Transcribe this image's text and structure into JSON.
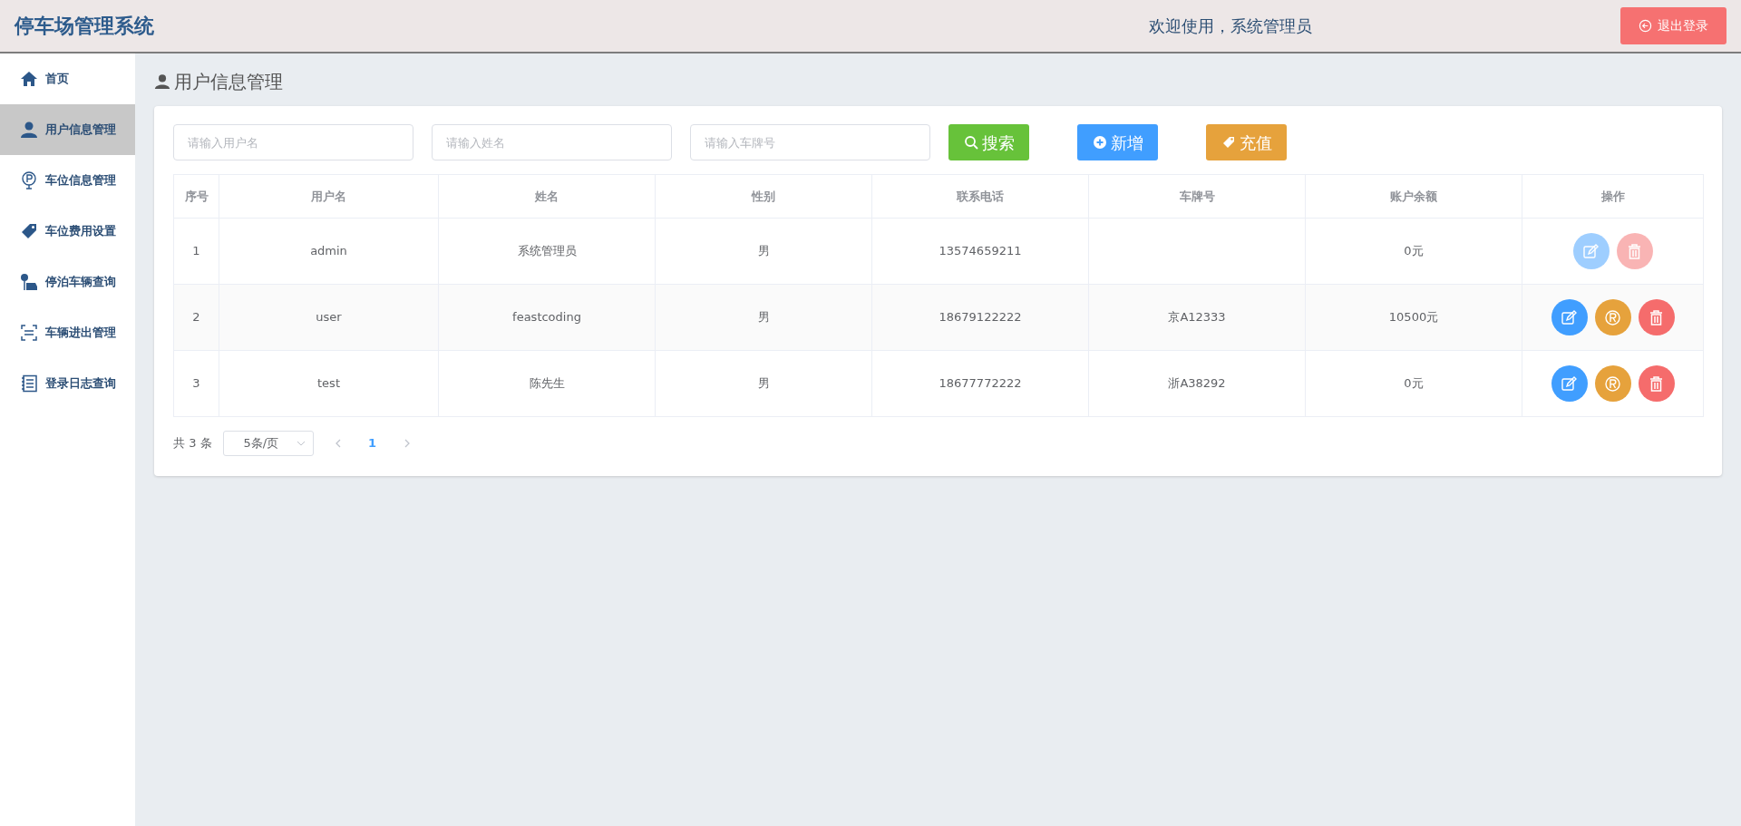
{
  "header": {
    "title": "停车场管理系统",
    "welcome": "欢迎使用，系统管理员",
    "logout_button": "退出登录"
  },
  "sidebar": {
    "items": [
      {
        "label": "首页",
        "kind": "home",
        "selected": false
      },
      {
        "label": "用户信息管理",
        "kind": "user",
        "selected": true
      },
      {
        "label": "车位信息管理",
        "kind": "parking",
        "selected": false
      },
      {
        "label": "车位费用设置",
        "kind": "tag",
        "selected": false
      },
      {
        "label": "停泊车辆查询",
        "kind": "car",
        "selected": false
      },
      {
        "label": "车辆进出管理",
        "kind": "scan",
        "selected": false
      },
      {
        "label": "登录日志查询",
        "kind": "notebook",
        "selected": false
      }
    ]
  },
  "page_title": "用户信息管理",
  "filters": [
    {
      "placeholder": "请输入用户名"
    },
    {
      "placeholder": "请输入姓名"
    },
    {
      "placeholder": "请输入车牌号"
    }
  ],
  "toolbar_buttons": [
    {
      "label": "搜索",
      "kind": "search"
    },
    {
      "label": "新增",
      "kind": "add"
    },
    {
      "label": "充值",
      "kind": "recharge"
    }
  ],
  "table": {
    "columns": [
      "序号",
      "用户名",
      "姓名",
      "性别",
      "联系电话",
      "车牌号",
      "账户余额",
      "操作"
    ],
    "rows": [
      {
        "cells": [
          "1",
          "admin",
          "系统管理员",
          "男",
          "13574659211",
          "",
          "0元"
        ],
        "actions": [
          {
            "kind": "edit",
            "disabled": true
          },
          {
            "kind": "delete",
            "disabled": true
          }
        ]
      },
      {
        "cells": [
          "2",
          "user",
          "feastcoding",
          "男",
          "18679122222",
          "京A12333",
          "10500元"
        ],
        "actions": [
          {
            "kind": "edit",
            "disabled": false
          },
          {
            "kind": "recharge",
            "disabled": false
          },
          {
            "kind": "delete",
            "disabled": false
          }
        ]
      },
      {
        "cells": [
          "3",
          "test",
          "陈先生",
          "男",
          "18677772222",
          "浙A38292",
          "0元"
        ],
        "actions": [
          {
            "kind": "edit",
            "disabled": false
          },
          {
            "kind": "recharge",
            "disabled": false
          },
          {
            "kind": "delete",
            "disabled": false
          }
        ]
      }
    ]
  },
  "pagination": {
    "total": "共 3 条",
    "page_size": "5条/页",
    "pages": [
      {
        "label": "1",
        "selected": true
      }
    ]
  }
}
